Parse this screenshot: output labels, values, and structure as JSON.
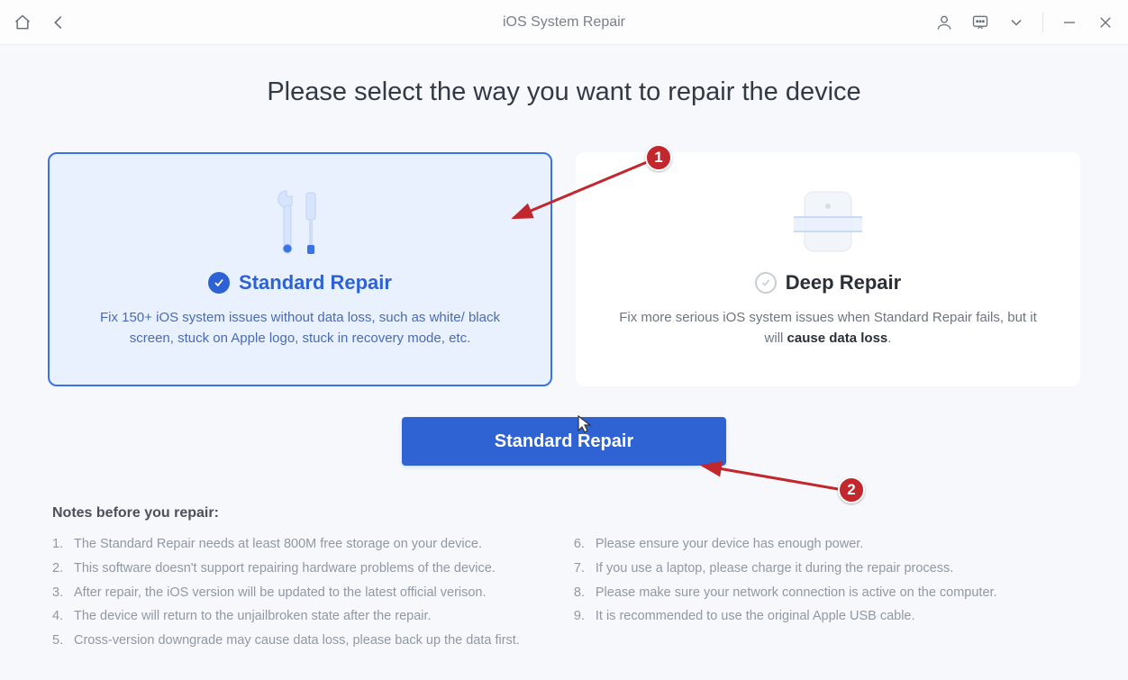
{
  "window": {
    "title": "iOS System Repair"
  },
  "headline": "Please select the way you want to repair the device",
  "cards": {
    "standard": {
      "title": "Standard Repair",
      "desc": "Fix 150+ iOS system issues without data loss, such as white/ black screen, stuck on Apple logo, stuck in recovery mode, etc."
    },
    "deep": {
      "title": "Deep Repair",
      "desc_prefix": "Fix more serious iOS system issues when Standard Repair fails, but it will ",
      "desc_bold": "cause data loss",
      "desc_suffix": "."
    }
  },
  "primary_button": "Standard Repair",
  "notes": {
    "title": "Notes before you repair:",
    "left": [
      {
        "n": "1.",
        "t": "The Standard Repair needs at least 800M free storage on your device."
      },
      {
        "n": "2.",
        "t": "This software doesn't support repairing hardware problems of the device."
      },
      {
        "n": "3.",
        "t": "After repair, the iOS version will be updated to the latest official verison."
      },
      {
        "n": "4.",
        "t": "The device will return to the unjailbroken state after the repair."
      },
      {
        "n": "5.",
        "t": "Cross-version downgrade may cause data loss, please back up the data first."
      }
    ],
    "right": [
      {
        "n": "6.",
        "t": "Please ensure your device has enough power."
      },
      {
        "n": "7.",
        "t": "If you use a laptop, please charge it during the repair process."
      },
      {
        "n": "8.",
        "t": "Please make sure your network connection is active on the computer."
      },
      {
        "n": "9.",
        "t": "It is recommended to use the original Apple USB cable."
      }
    ]
  },
  "annotations": {
    "badge1": "1",
    "badge2": "2"
  }
}
